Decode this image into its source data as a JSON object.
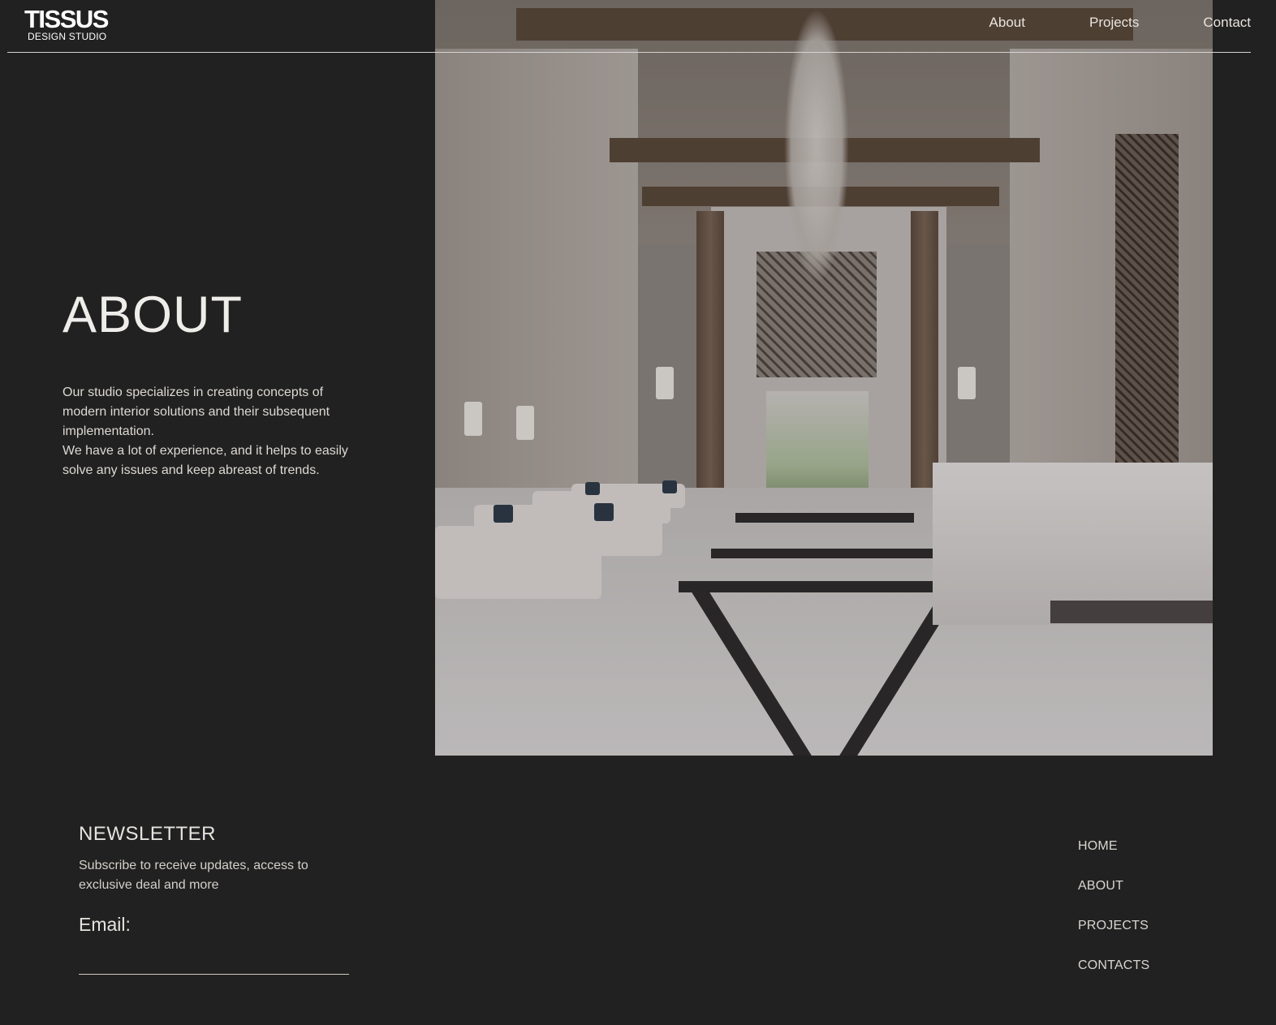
{
  "header": {
    "logo_main": "TISSUS",
    "logo_sub": "DESIGN  STUDIO",
    "nav": [
      "About",
      "Projects",
      "Contact"
    ]
  },
  "hero": {
    "image": "lobby-interior-photo"
  },
  "about": {
    "title": "ABOUT",
    "paragraph_1": "Our studio specializes in creating concepts of modern interior solutions and their subsequent implementation.",
    "paragraph_2": "We have a lot of experience, and it helps to easily solve any issues and keep abreast of trends."
  },
  "newsletter": {
    "title": "NEWSLETTER",
    "subtitle": "Subscribe to receive updates, access to exclusive deal and more",
    "email_label": "Email:",
    "email_value": "",
    "email_placeholder": ""
  },
  "footer_nav": [
    "HOME",
    "ABOUT",
    "PROJECTS",
    "CONTACTS"
  ],
  "colors": {
    "background": "#212121",
    "text": "#d9d9d9",
    "header_line": "#d4d4d4"
  }
}
